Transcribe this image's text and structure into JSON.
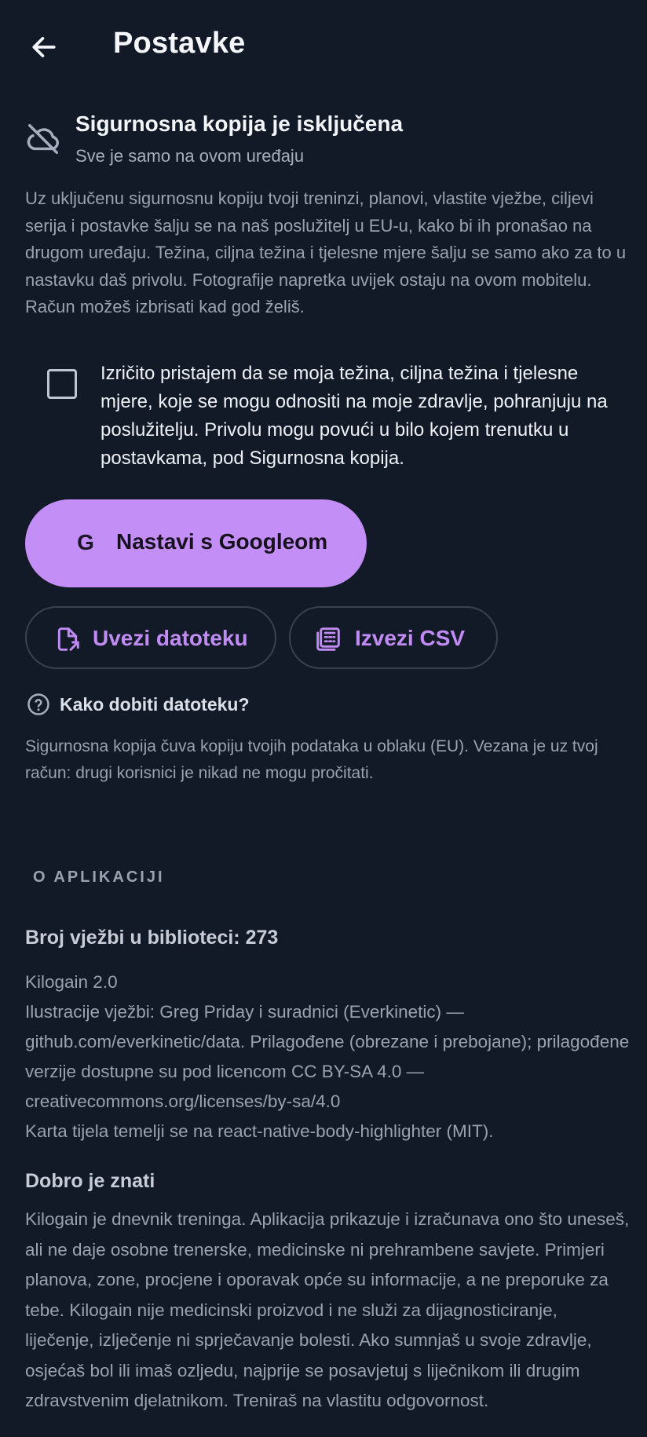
{
  "header": {
    "title": "Postavke"
  },
  "backup": {
    "status_title": "Sigurnosna kopija je isključena",
    "status_subtitle": "Sve je samo na ovom uređaju",
    "description": "Uz uključenu sigurnosnu kopiju tvoji treninzi, planovi, vlastite vježbe, ciljevi serija i postavke šalju se na naš poslužitelj u EU-u, kako bi ih pronašao na drugom uređaju. Težina, ciljna težina i tjelesne mjere šalju se samo ako za to u nastavku daš privolu. Fotografije napretka uvijek ostaju na ovom mobitelu. Račun možeš izbrisati kad god želiš.",
    "consent_text": "Izričito pristajem da se moja težina, ciljna težina i tjelesne mjere, koje se mogu odnositi na moje zdravlje, pohranjuju na poslužitelju. Privolu mogu povući u bilo kojem trenutku u postavkama, pod Sigurnosna kopija.",
    "google_button": "Nastavi s Googleom",
    "google_glyph": "G",
    "import_button": "Uvezi datoteku",
    "export_button": "Izvezi CSV",
    "help_link": "Kako dobiti datoteku?",
    "footnote": "Sigurnosna kopija čuva kopiju tvojih podataka u oblaku (EU). Vezana je uz tvoj račun: drugi korisnici je nikad ne mogu pročitati."
  },
  "about": {
    "section_label": "O APLIKACIJI",
    "library_count": "Broj vježbi u biblioteci: 273",
    "app_version": "Kilogain 2.0",
    "illustrations_credit": "Ilustracije vježbi: Greg Priday i suradnici (Everkinetic) — github.com/everkinetic/data. Prilagođene (obrezane i prebojane); prilagođene verzije dostupne su pod licencom CC BY-SA 4.0 — creativecommons.org/licenses/by-sa/4.0",
    "body_map_credit": "Karta tijela temelji se na react-native-body-highlighter (MIT).",
    "good_to_know_title": "Dobro je znati",
    "disclaimer": "Kilogain je dnevnik treninga. Aplikacija prikazuje i izračunava ono što uneseš, ali ne daje osobne trenerske, medicinske ni prehrambene savjete. Primjeri planova, zone, procjene i oporavak opće su informacije, a ne preporuke za tebe. Kilogain nije medicinski proizvod i ne služi za dijagnosticiranje, liječenje, izlječenje ni sprječavanje bolesti. Ako sumnjaš u svoje zdravlje, osjećaš bol ili imaš ozljedu, najprije se posavjetuj s liječnikom ili drugim zdravstvenim djelatnikom. Treniraš na vlastitu odgovornost."
  },
  "colors": {
    "background": "#131a27",
    "accent": "#c38ff7",
    "accent_text": "#c08cf4",
    "muted_text": "#9aa2b1"
  },
  "icons": {
    "back": "arrow-left-icon",
    "backup_status": "cloud-off-icon",
    "import": "file-import-icon",
    "export": "calculator-grid-icon",
    "help": "help-circle-icon"
  }
}
